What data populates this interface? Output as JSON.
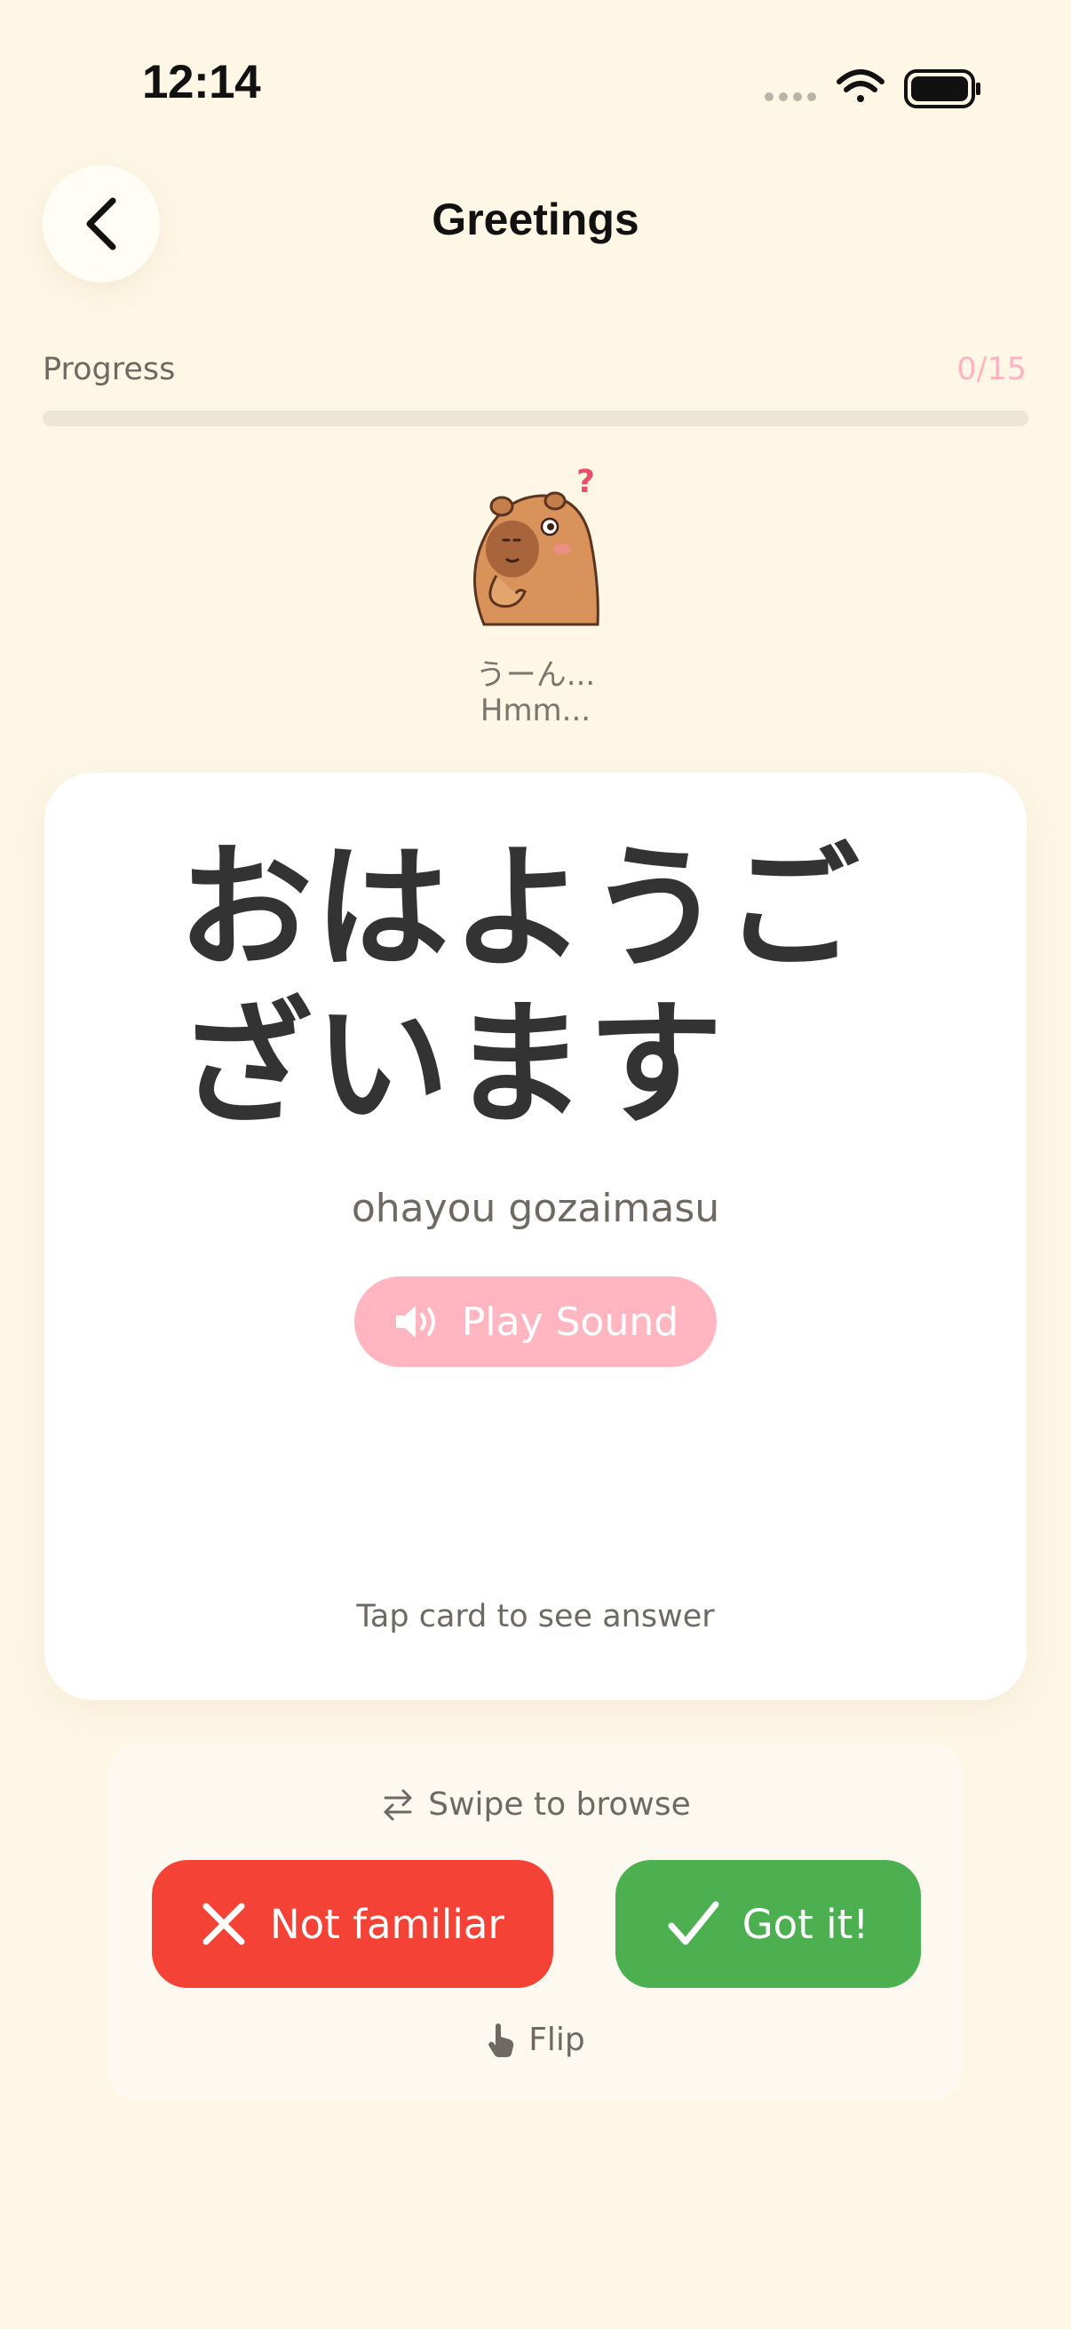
{
  "status_bar": {
    "time": "12:14"
  },
  "header": {
    "title": "Greetings",
    "back_icon": "chevron-left-icon"
  },
  "progress": {
    "label": "Progress",
    "count": "0/15",
    "fraction": 0,
    "color": "#FFB3C0"
  },
  "mascot": {
    "icon": "capybara-thinking-icon",
    "text_jp": "うーん...",
    "text_en": "Hmm..."
  },
  "card": {
    "word": "おはようございます",
    "romaji": "ohayou gozaimasu",
    "play_label": "Play Sound",
    "hint": "Tap card to see answer"
  },
  "actions": {
    "swipe_hint": "Swipe to browse",
    "not_familiar_label": "Not familiar",
    "got_it_label": "Got it!",
    "flip_label": "Flip"
  },
  "colors": {
    "background": "#FEF7E6",
    "accent_pink": "#FFB6C1",
    "danger_red": "#F44336",
    "success_green": "#4CAF50"
  }
}
